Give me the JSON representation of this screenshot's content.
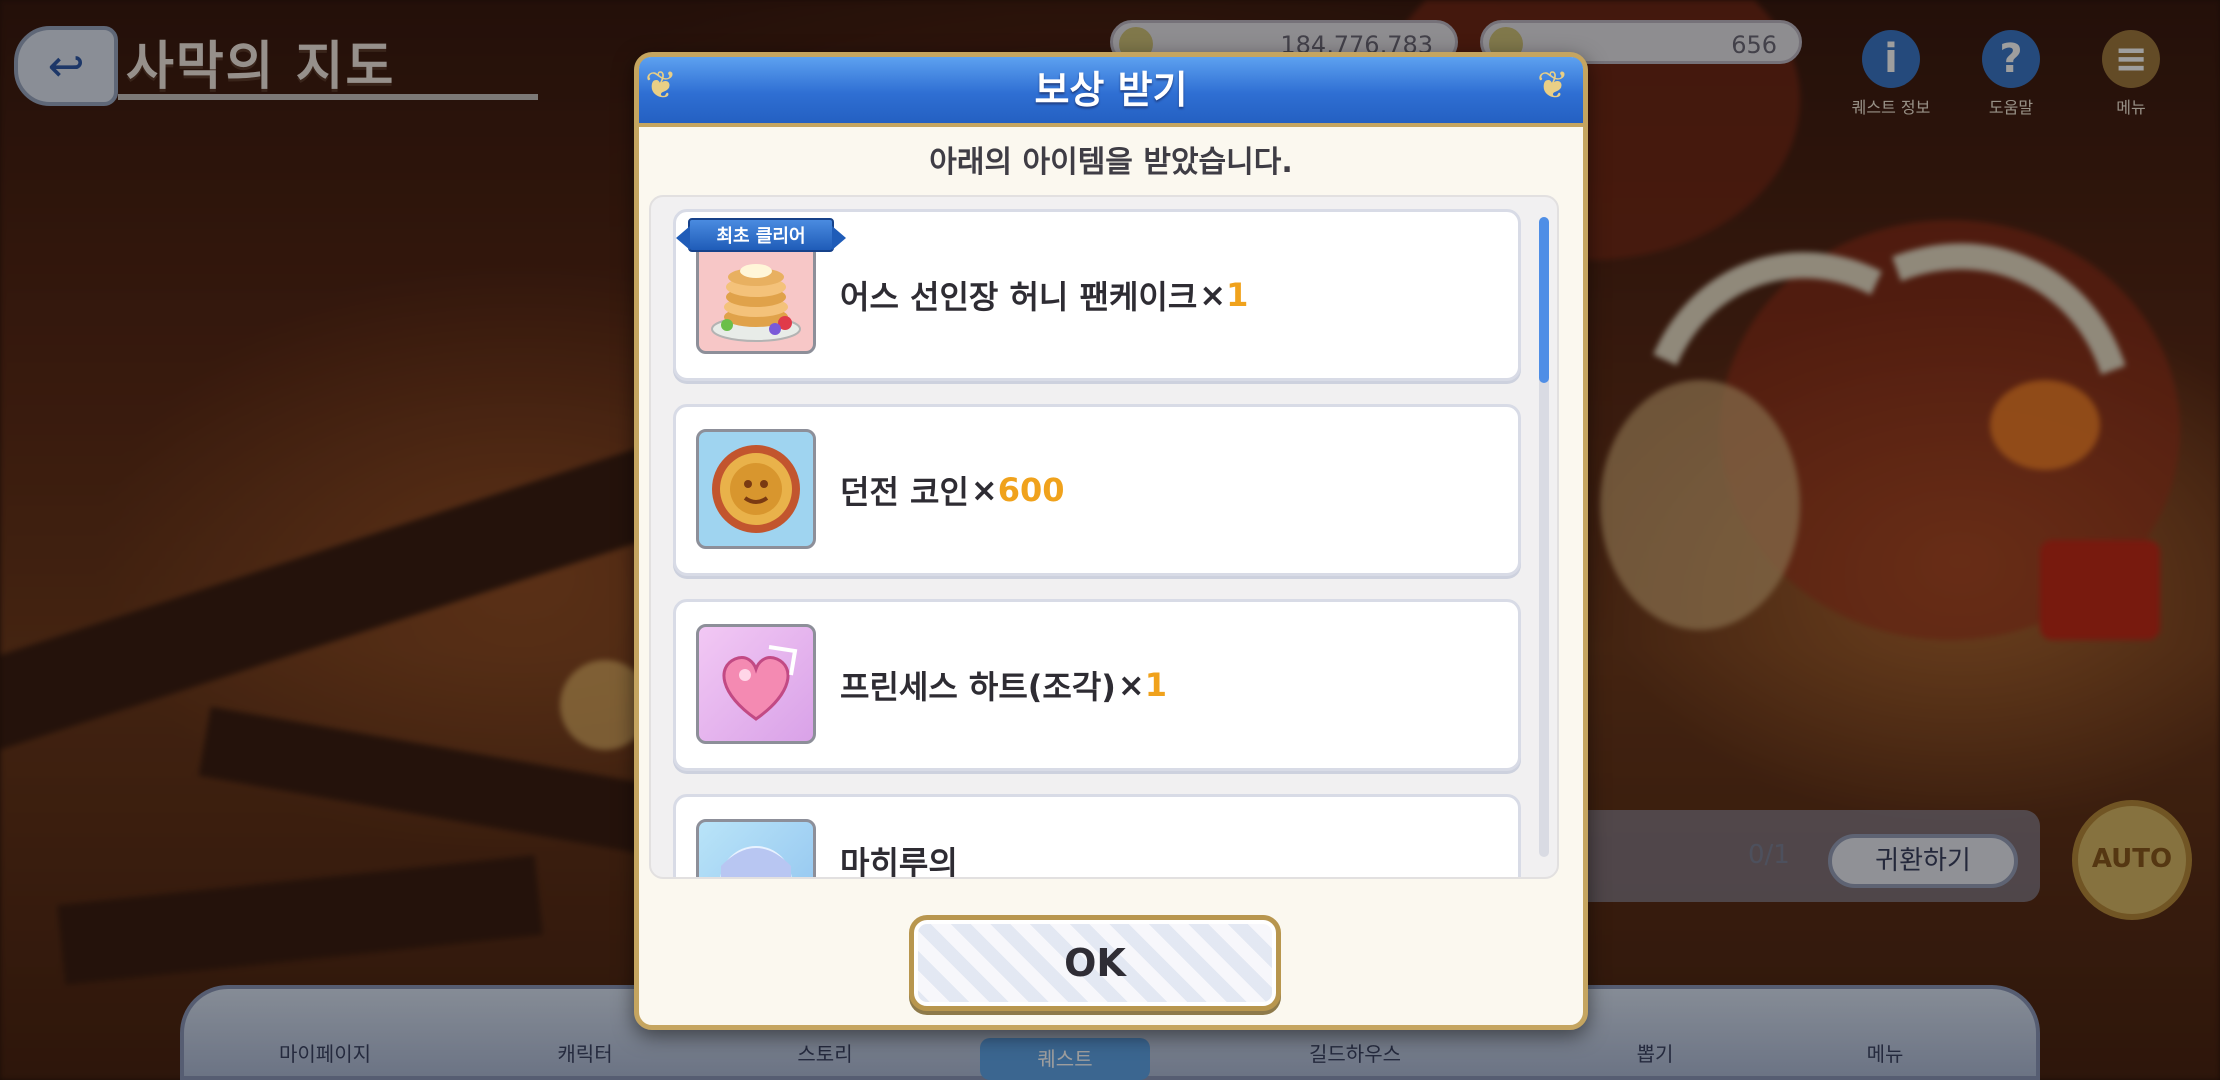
{
  "background": {
    "stage_title": "사막의 지도",
    "currency_left": "184,776,783",
    "currency_right": "656",
    "hud_icons": [
      {
        "label": "퀘스트 정보",
        "icon": "info-icon",
        "glyph": "i"
      },
      {
        "label": "도움말",
        "icon": "help-icon",
        "glyph": "?"
      },
      {
        "label": "메뉴",
        "icon": "menu-icon",
        "glyph": "≡"
      }
    ],
    "quest_count": "0/1",
    "return_button": "귀환하기",
    "auto_button": "AUTO",
    "bottom_nav": [
      "마이페이지",
      "캐릭터",
      "스토리",
      "퀘스트",
      "길드하우스",
      "뽑기",
      "메뉴"
    ]
  },
  "modal": {
    "title": "보상 받기",
    "subtitle": "아래의 아이템을 받았습니다.",
    "first_clear_badge": "최초 클리어",
    "ok_label": "OK",
    "items": [
      {
        "name": "어스 선인장 허니 팬케이크",
        "x": "×",
        "qty": "1",
        "icon": "pancake-icon",
        "first_clear": true
      },
      {
        "name": "던전 코인",
        "x": "×",
        "qty": "600",
        "icon": "dungeon-coin-icon",
        "first_clear": false
      },
      {
        "name": "프린세스 하트(조각)",
        "x": "×",
        "qty": "1",
        "icon": "princess-heart-icon",
        "first_clear": false
      },
      {
        "name": "마히루의",
        "x": "",
        "qty": "",
        "icon": "character-memory-piece-icon",
        "first_clear": false
      }
    ],
    "scroll_position": 0.0
  },
  "colors": {
    "header_blue": "#2f6fd3",
    "gold_border": "#c5a560",
    "quantity_orange": "#f0a21c"
  }
}
